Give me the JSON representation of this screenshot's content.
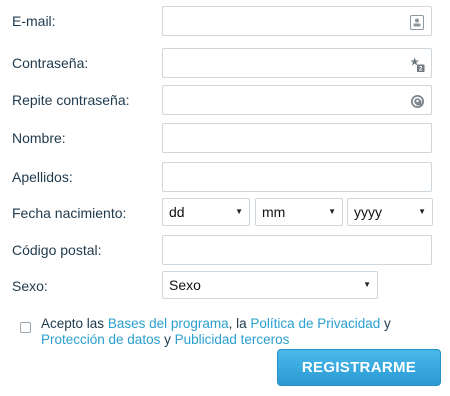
{
  "form": {
    "email": {
      "label": "E-mail:",
      "value": ""
    },
    "password": {
      "label": "Contraseña:",
      "value": ""
    },
    "password_repeat": {
      "label": "Repite contraseña:",
      "value": ""
    },
    "first_name": {
      "label": "Nombre:",
      "value": ""
    },
    "last_name": {
      "label": "Apellidos:",
      "value": ""
    },
    "birth_date": {
      "label": "Fecha nacimiento:",
      "day": "dd",
      "month": "mm",
      "year": "yyyy"
    },
    "postal_code": {
      "label": "Código postal:",
      "value": ""
    },
    "sex": {
      "label": "Sexo:",
      "selected": "Sexo"
    }
  },
  "terms": {
    "prefix": "Acepto las",
    "link_bases": "Bases del programa",
    "sep1": ", la",
    "link_privacy": "Política de Privacidad",
    "sep2": "y",
    "link_data": "Protección de datos",
    "sep3": "y",
    "link_ads": "Publicidad terceros",
    "checked": false
  },
  "register_button": "REGISTRARME",
  "colors": {
    "link": "#2a9fd0",
    "button": "#2b9ad3",
    "label": "#1f3a4d"
  }
}
